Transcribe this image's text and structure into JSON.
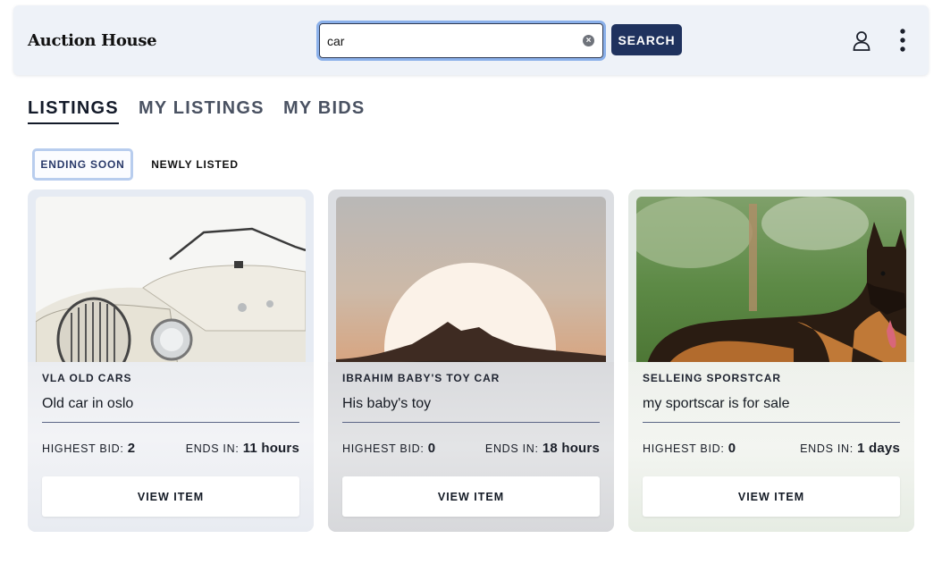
{
  "app": {
    "title": "Auction House"
  },
  "search": {
    "value": "car",
    "placeholder": "",
    "button_label": "SEARCH"
  },
  "header_icons": {
    "user": "user-icon",
    "more": "more-vertical-icon"
  },
  "tabs": [
    {
      "label": "LISTINGS",
      "active": true
    },
    {
      "label": "MY LISTINGS",
      "active": false
    },
    {
      "label": "MY BIDS",
      "active": false
    }
  ],
  "filters": [
    {
      "label": "ENDING SOON",
      "active": true
    },
    {
      "label": "NEWLY LISTED",
      "active": false
    }
  ],
  "listings": [
    {
      "seller": "VLA OLD CARS",
      "title": "Old car in oslo",
      "highest_bid_label": "HIGHEST BID:",
      "highest_bid": "2",
      "ends_label": "ENDS IN:",
      "ends_in": "11 hours",
      "button": "VIEW ITEM",
      "image": "vintage-car-photo"
    },
    {
      "seller": "IBRAHIM BABY'S TOY CAR",
      "title": "His baby's toy",
      "highest_bid_label": "HIGHEST BID:",
      "highest_bid": "0",
      "ends_label": "ENDS IN:",
      "ends_in": "18 hours",
      "button": "VIEW ITEM",
      "image": "sunset-hill-photo"
    },
    {
      "seller": "SELLEING SPORSTCAR",
      "title": "my sportscar is for sale",
      "highest_bid_label": "HIGHEST BID:",
      "highest_bid": "0",
      "ends_label": "ENDS IN:",
      "ends_in": "1 days",
      "button": "VIEW ITEM",
      "image": "german-shepherd-photo"
    }
  ],
  "colors": {
    "header_bg": "#eef2f8",
    "search_button": "#1f325e",
    "search_focus": "#8ab0ea",
    "active_filter_border": "#b8cdee"
  }
}
